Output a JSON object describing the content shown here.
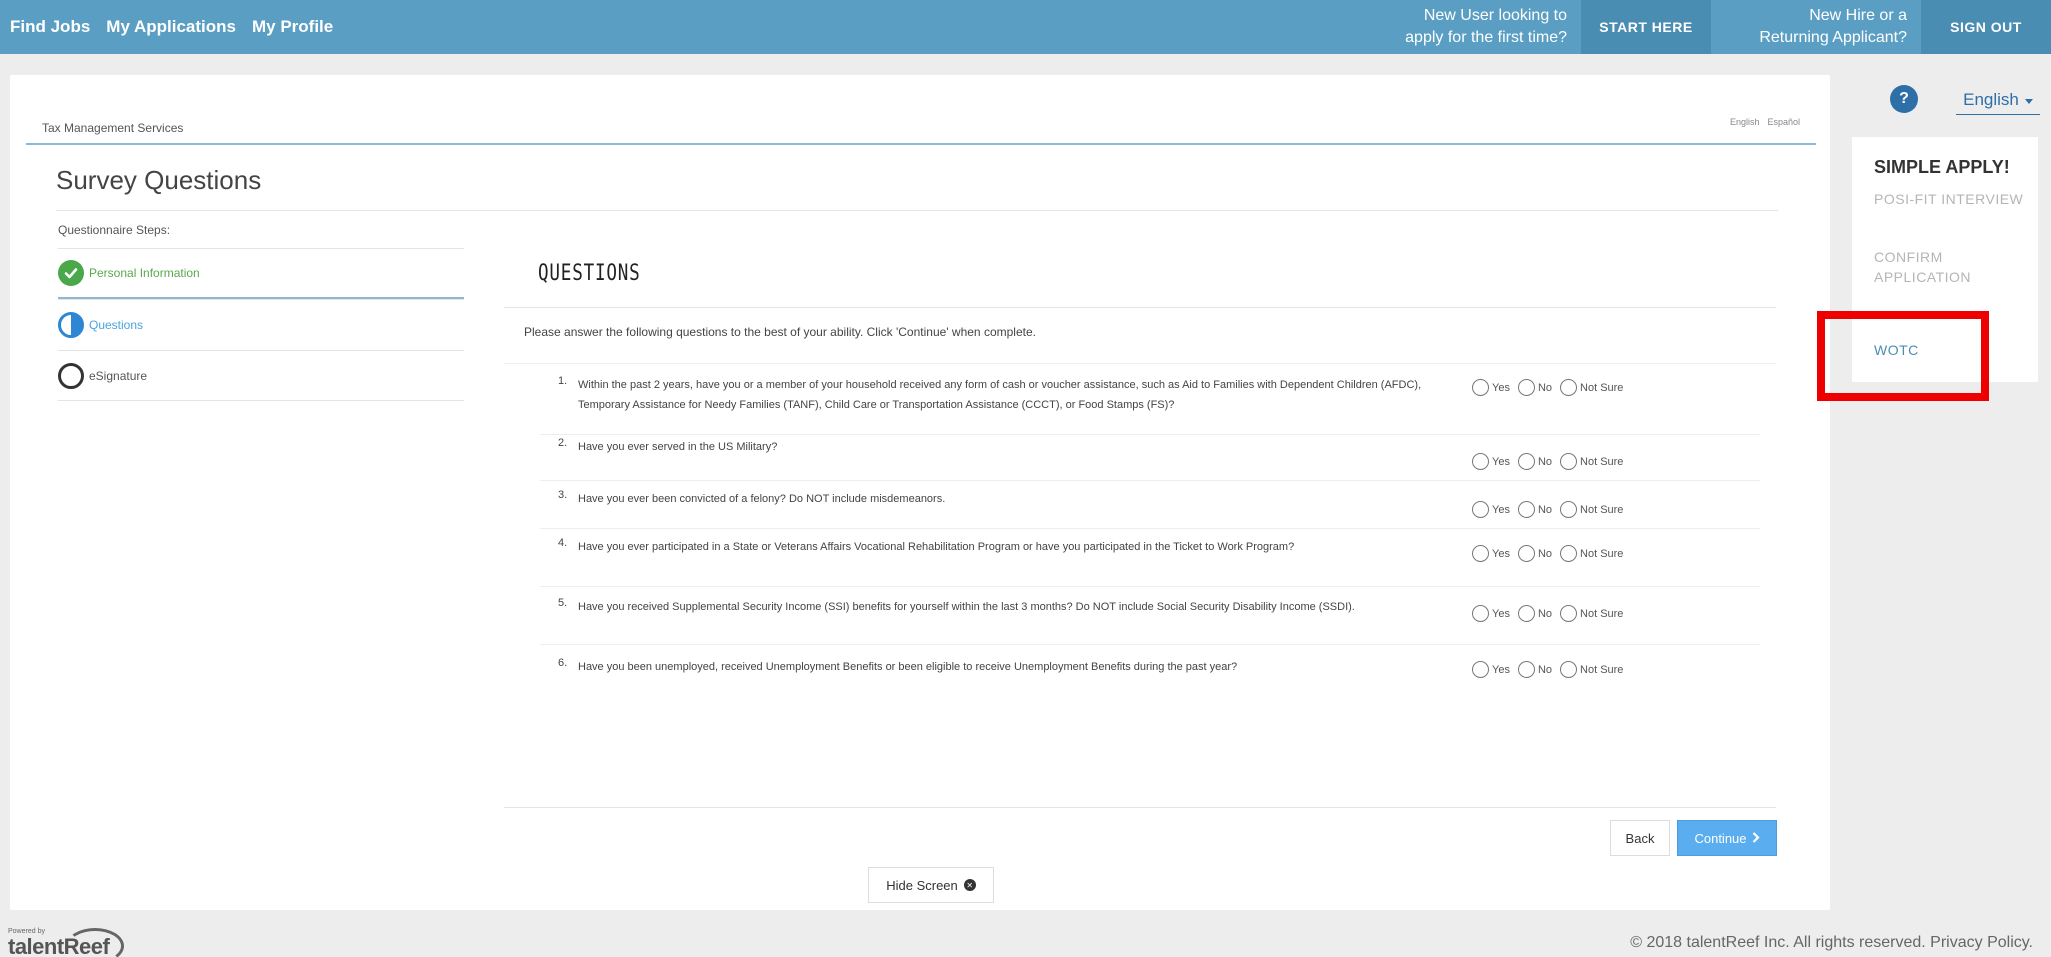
{
  "topbar": {
    "nav": [
      "Find Jobs",
      "My Applications",
      "My Profile"
    ],
    "new_user_text": "New User looking to apply for the first time?",
    "start_here": "START HERE",
    "new_hire_text": "New Hire or a Returning Applicant?",
    "sign_out": "SIGN OUT"
  },
  "header": {
    "brand": "Tax Management Services",
    "lang_english": "English",
    "lang_espanol": "Español"
  },
  "page_title": "Survey Questions",
  "steps": {
    "label": "Questionnaire Steps:",
    "items": [
      {
        "label": "Personal Information",
        "state": "complete",
        "icon": "check-circle-icon"
      },
      {
        "label": "Questions",
        "state": "current",
        "icon": "half-circle-icon"
      },
      {
        "label": "eSignature",
        "state": "pending",
        "icon": "empty-circle-icon"
      }
    ]
  },
  "questions": {
    "heading": "QUESTIONS",
    "instructions": "Please answer the following questions to the best of your ability.  Click 'Continue' when complete.",
    "option_labels": [
      "Yes",
      "No",
      "Not Sure"
    ],
    "items": [
      {
        "num": "1.",
        "text": "Within the past 2 years, have you or a member of your household received any form of cash or voucher assistance, such as Aid to Families with Dependent Children (AFDC), Temporary Assistance for Needy Families (TANF), Child Care or Transportation Assistance (CCCT), or Food Stamps (FS)?"
      },
      {
        "num": "2.",
        "text": "Have you ever served in the US Military?"
      },
      {
        "num": "3.",
        "text": "Have you ever been convicted of a felony? Do NOT include misdemeanors."
      },
      {
        "num": "4.",
        "text": "Have you ever participated in a State or Veterans Affairs Vocational Rehabilitation Program or have you participated in the Ticket to Work Program?"
      },
      {
        "num": "5.",
        "text": "Have you received Supplemental Security Income (SSI) benefits for yourself within the last 3 months? Do NOT include Social Security Disability Income (SSDI)."
      },
      {
        "num": "6.",
        "text": "Have you been unemployed, received Unemployment Benefits or been eligible to receive Unemployment Benefits during the past year?"
      }
    ]
  },
  "buttons": {
    "back": "Back",
    "continue": "Continue",
    "hide_screen": "Hide Screen"
  },
  "sidebar": {
    "help": "?",
    "language": "English",
    "title": "SIMPLE APPLY!",
    "items": [
      "POSI-FIT INTERVIEW",
      "CONFIRM APPLICATION",
      "WOTC"
    ]
  },
  "footer": {
    "powered_by": "Powered by",
    "logo": "talentReef",
    "copyright": "© 2018 talentReef Inc. All rights reserved. Privacy Policy."
  },
  "colors": {
    "topbar": "#5a9fc3",
    "accent": "#4a8db3",
    "complete": "#4aa84b",
    "current": "#2f86d3",
    "continue_button": "#5aaeef",
    "highlight_box": "#ee0000"
  }
}
